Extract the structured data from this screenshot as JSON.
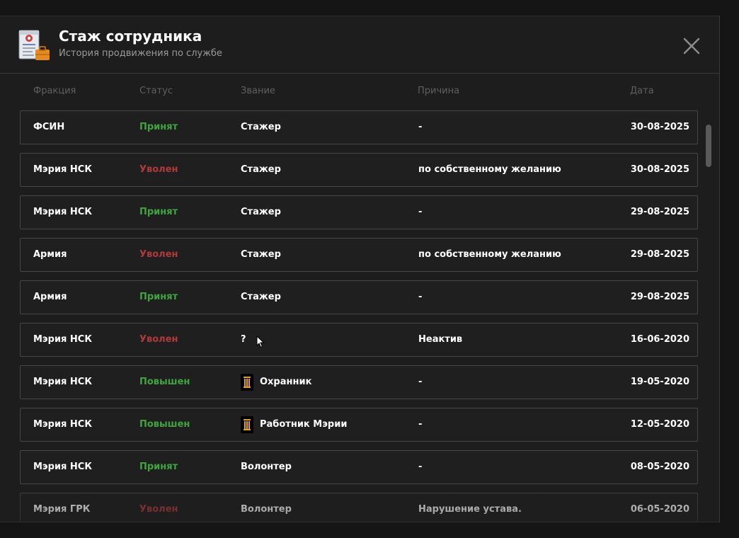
{
  "header": {
    "title": "Стаж сотрудника",
    "subtitle": "История продвижения по службе",
    "icon": "document-briefcase-icon",
    "close_icon": "close-icon"
  },
  "columns": {
    "faction": "Фракция",
    "status": "Статус",
    "rank": "Звание",
    "reason": "Причина",
    "date": "Дата"
  },
  "colors": {
    "accepted": "#3fa53f",
    "fired": "#b03a3a",
    "background": "#1d1d1d"
  },
  "rows": [
    {
      "faction": "ФСИН",
      "status": "Принят",
      "status_type": "green",
      "rank": "Стажер",
      "rank_icon": false,
      "reason": "-",
      "date": "30-08-2025"
    },
    {
      "faction": "Мэрия НСК",
      "status": "Уволен",
      "status_type": "red",
      "rank": "Стажер",
      "rank_icon": false,
      "reason": "по собственному желанию",
      "date": "30-08-2025"
    },
    {
      "faction": "Мэрия НСК",
      "status": "Принят",
      "status_type": "green",
      "rank": "Стажер",
      "rank_icon": false,
      "reason": "-",
      "date": "29-08-2025"
    },
    {
      "faction": "Армия",
      "status": "Уволен",
      "status_type": "red",
      "rank": "Стажер",
      "rank_icon": false,
      "reason": "по собственному желанию",
      "date": "29-08-2025"
    },
    {
      "faction": "Армия",
      "status": "Принят",
      "status_type": "green",
      "rank": "Стажер",
      "rank_icon": false,
      "reason": "-",
      "date": "29-08-2025"
    },
    {
      "faction": "Мэрия НСК",
      "status": "Уволен",
      "status_type": "red",
      "rank": "?",
      "rank_icon": false,
      "reason": "Неактив",
      "date": "16-06-2020"
    },
    {
      "faction": "Мэрия НСК",
      "status": "Повышен",
      "status_type": "green",
      "rank": "Охранник",
      "rank_icon": true,
      "reason": "-",
      "date": "19-05-2020"
    },
    {
      "faction": "Мэрия НСК",
      "status": "Повышен",
      "status_type": "green",
      "rank": "Работник Мэрии",
      "rank_icon": true,
      "reason": "-",
      "date": "12-05-2020"
    },
    {
      "faction": "Мэрия НСК",
      "status": "Принят",
      "status_type": "green",
      "rank": "Волонтер",
      "rank_icon": false,
      "reason": "-",
      "date": "08-05-2020"
    },
    {
      "faction": "Мэрия ГРК",
      "status": "Уволен",
      "status_type": "red",
      "rank": "Волонтер",
      "rank_icon": false,
      "reason": "Нарушение устава.",
      "date": "06-05-2020"
    }
  ]
}
